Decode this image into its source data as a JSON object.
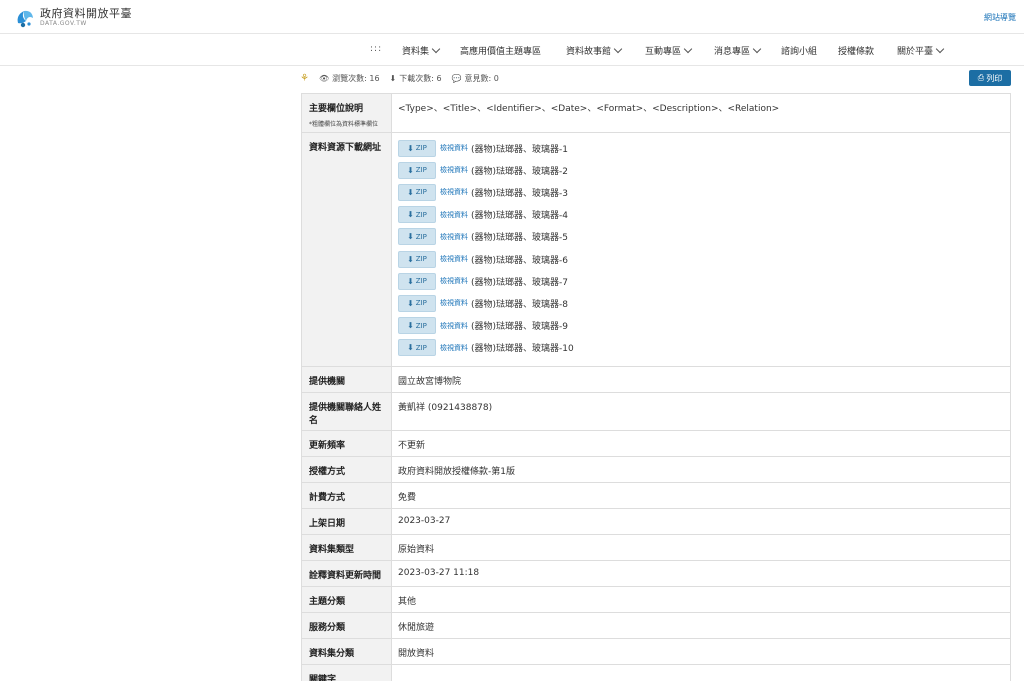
{
  "header": {
    "logo_zh": "政府資料開放平臺",
    "logo_en": "DATA.GOV.TW",
    "sitemap": "網站導覽"
  },
  "nav": {
    "menu_dots": ":::",
    "items": [
      {
        "label": "資料集",
        "has_dropdown": true
      },
      {
        "label": "高應用價值主題專區",
        "has_dropdown": false
      },
      {
        "label": "資料故事館",
        "has_dropdown": true
      },
      {
        "label": "互動專區",
        "has_dropdown": true
      },
      {
        "label": "消息專區",
        "has_dropdown": true
      },
      {
        "label": "諮詢小組",
        "has_dropdown": false
      },
      {
        "label": "授權條款",
        "has_dropdown": false
      },
      {
        "label": "關於平臺",
        "has_dropdown": true
      }
    ]
  },
  "stats": {
    "views": "瀏覽次數: 16",
    "downloads": "下載次數: 6",
    "comments": "意見數: 0",
    "print": "列印"
  },
  "fields": {
    "main_field": {
      "label": "主要欄位說明",
      "sub": "*粗體欄位為資料標準欄位",
      "value": "<Type>、<Title>、<Identifier>、<Date>、<Format>、<Description>、<Relation>"
    },
    "download": {
      "label": "資料資源下載網址",
      "zip_label": "ZIP",
      "preview_label": "檢視資料",
      "files": [
        "(器物)琺瑯器、玻璃器-1",
        "(器物)琺瑯器、玻璃器-2",
        "(器物)琺瑯器、玻璃器-3",
        "(器物)琺瑯器、玻璃器-4",
        "(器物)琺瑯器、玻璃器-5",
        "(器物)琺瑯器、玻璃器-6",
        "(器物)琺瑯器、玻璃器-7",
        "(器物)琺瑯器、玻璃器-8",
        "(器物)琺瑯器、玻璃器-9",
        "(器物)琺瑯器、玻璃器-10"
      ]
    },
    "provider": {
      "label": "提供機關",
      "value": "國立故宮博物院"
    },
    "contact": {
      "label": "提供機關聯絡人姓名",
      "value": "黃凱祥 (0921438878)"
    },
    "frequency": {
      "label": "更新頻率",
      "value": "不更新"
    },
    "license": {
      "label": "授權方式",
      "value": "政府資料開放授權條款-第1版"
    },
    "fee": {
      "label": "計費方式",
      "value": "免費"
    },
    "listed": {
      "label": "上架日期",
      "value": "2023-03-27"
    },
    "type": {
      "label": "資料集類型",
      "value": "原始資料"
    },
    "meta_updated": {
      "label": "詮釋資料更新時間",
      "value": "2023-03-27 11:18"
    },
    "topic": {
      "label": "主題分類",
      "value": "其他"
    },
    "service": {
      "label": "服務分類",
      "value": "休閒旅遊"
    },
    "category": {
      "label": "資料集分類",
      "value": "開放資料"
    },
    "keywords": {
      "label": "關鍵字",
      "value": ""
    }
  }
}
